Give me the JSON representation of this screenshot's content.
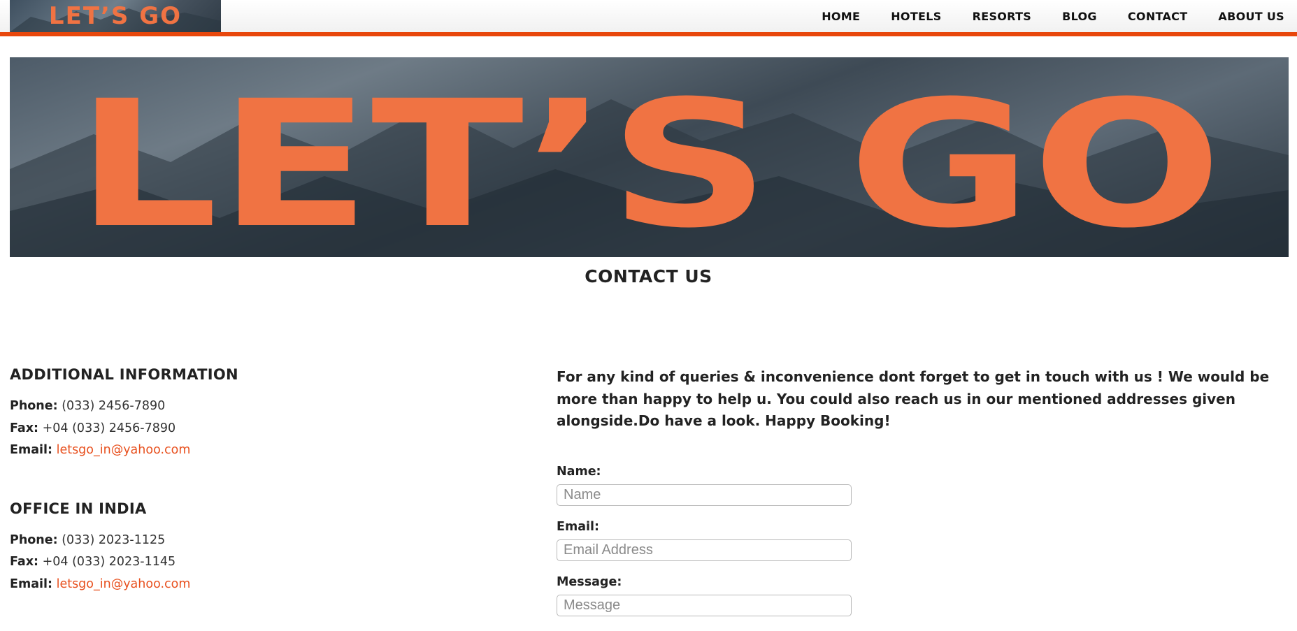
{
  "header": {
    "logo_text": "LET’S GO",
    "nav": [
      "HOME",
      "HOTELS",
      "RESORTS",
      "BLOG",
      "CONTACT",
      "ABOUT US"
    ]
  },
  "banner": {
    "logo_text": "LET’S GO"
  },
  "page_title": "CONTACT US",
  "additional_info": {
    "heading": "ADDITIONAL INFORMATION",
    "phone_label": "Phone:",
    "phone": "(033) 2456-7890",
    "fax_label": "Fax:",
    "fax": "+04 (033) 2456-7890",
    "email_label": "Email:",
    "email": "letsgo_in@yahoo.com"
  },
  "office_india": {
    "heading": "OFFICE IN INDIA",
    "phone_label": "Phone:",
    "phone": "(033) 2023-1125",
    "fax_label": "Fax:",
    "fax": "+04 (033) 2023-1145",
    "email_label": "Email:",
    "email": "letsgo_in@yahoo.com"
  },
  "intro": "For any kind of queries & inconvenience dont forget to get in touch with us ! We would be more than happy to help u. You could also reach us in our mentioned addresses given alongside.Do have a look. Happy Booking!",
  "form": {
    "name_label": "Name:",
    "name_placeholder": "Name",
    "email_label": "Email:",
    "email_placeholder": "Email Address",
    "message_label": "Message:",
    "message_placeholder": "Message"
  },
  "colors": {
    "accent": "#e8470c",
    "logo_orange": "#f07343",
    "link": "#e8501e"
  }
}
